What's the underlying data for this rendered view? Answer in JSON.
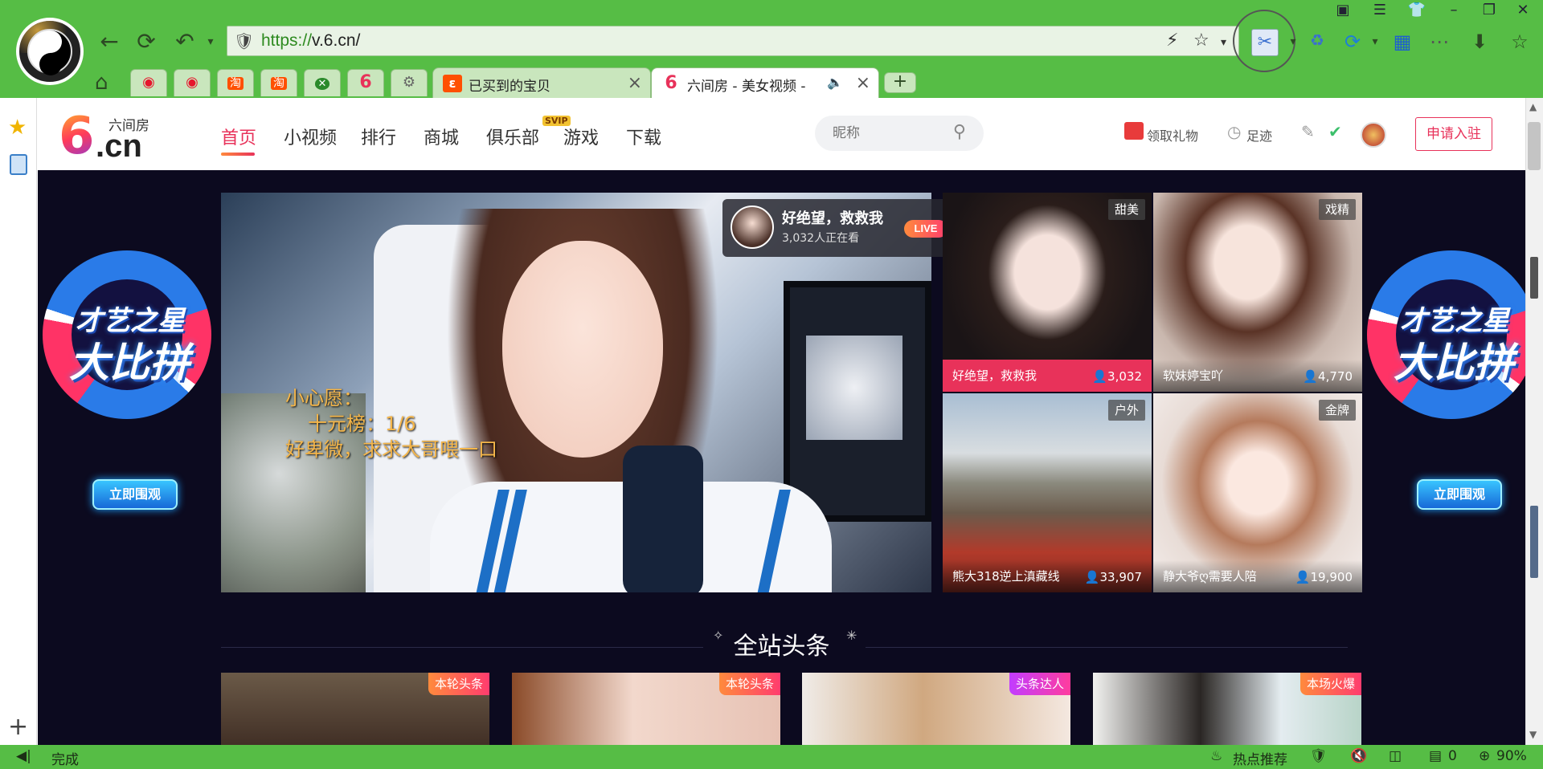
{
  "browser": {
    "url_scheme": "https://",
    "url_rest": "v.6.cn/",
    "tabs": [
      {
        "label": "已买到的宝贝",
        "favicon": "taobao-icon",
        "favicon_color": "#ff5000"
      },
      {
        "label": "六间房 - 美女视频 -",
        "favicon": "six-icon",
        "favicon_color": "#e8325a"
      }
    ],
    "mini_tabs": [
      "weibo-icon",
      "weibo-icon",
      "淘",
      "淘",
      "close-icon",
      "6",
      "gear-icon"
    ],
    "status_left": "完成",
    "status_hot": "热点推荐",
    "status_count": "0",
    "zoom": "90%"
  },
  "site": {
    "logo_sub": "六间房",
    "logo_cn": ".cn",
    "logo_six": "6",
    "nav": [
      {
        "label": "首页",
        "active": true
      },
      {
        "label": "小视频"
      },
      {
        "label": "排行"
      },
      {
        "label": "商城"
      },
      {
        "label": "俱乐部",
        "badge": "SVIP"
      },
      {
        "label": "游戏"
      },
      {
        "label": "下载"
      }
    ],
    "search_placeholder": "昵称",
    "gift_label": "领取礼物",
    "footprint_label": "足迹",
    "apply_label": "申请入驻"
  },
  "banner": {
    "title_line1": "才艺之星",
    "title_line2": "大比拼",
    "button": "立即围观"
  },
  "main_live": {
    "streamer": "好绝望，救救我",
    "viewers": "3,032人正在看",
    "live_badge": "LIVE",
    "wish_lines": [
      "小心愿：",
      "十元榜：1/6",
      "好卑微，求求大哥喂一口"
    ]
  },
  "thumbs": [
    {
      "tag": "甜美",
      "name": "好绝望，救救我",
      "count": "3,032",
      "highlight": true
    },
    {
      "tag": "戏精",
      "name": "软妹婷宝吖",
      "count": "4,770"
    },
    {
      "tag": "户外",
      "name": "熊大318逆上滇藏线",
      "count": "33,907"
    },
    {
      "tag": "金牌",
      "name": "静大爷ღ需要人陪",
      "count": "19,900"
    }
  ],
  "headlines": {
    "title": "全站头条",
    "cards": [
      {
        "tag": "本轮头条"
      },
      {
        "tag": "本轮头条"
      },
      {
        "tag": "头条达人"
      },
      {
        "tag": "本场火爆"
      }
    ]
  },
  "colors": {
    "browser_green": "#56bd45",
    "brand_red": "#e8325a",
    "page_bg": "#0c0a1f"
  }
}
